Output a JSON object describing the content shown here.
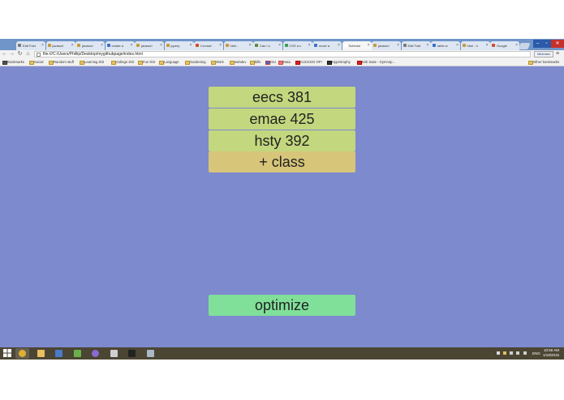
{
  "browser": {
    "tabs": [
      {
        "label": "Edit Fold",
        "color": "#7a7a7a"
      },
      {
        "label": "javascri",
        "color": "#c89a3a"
      },
      {
        "label": "javascri",
        "color": "#c89a3a"
      },
      {
        "label": "create a",
        "color": "#3a6fc8"
      },
      {
        "label": "javascri",
        "color": "#c89a3a"
      },
      {
        "label": "jquery",
        "color": "#c89a3a"
      },
      {
        "label": "Cronwe",
        "color": "#d24a2a"
      },
      {
        "label": "html -",
        "color": "#c89a3a"
      },
      {
        "label": "Can I u",
        "color": "#5a8a3a"
      },
      {
        "label": "CSS a c",
        "color": "#3aa04a"
      },
      {
        "label": "move a",
        "color": "#3a6fc8"
      },
      {
        "label": "Schedul",
        "color": "#ffffff"
      },
      {
        "label": "javascri",
        "color": "#c89a3a"
      },
      {
        "label": "Edit Fold",
        "color": "#7a7a7a"
      },
      {
        "label": "table w",
        "color": "#3a6fc8"
      },
      {
        "label": "html - h",
        "color": "#c89a3a"
      },
      {
        "label": "Google",
        "color": "#d24a2a"
      }
    ],
    "active_tab": 11,
    "window_controls": {
      "minimize": "–",
      "maximize": "▫",
      "close": "✕"
    },
    "address": "file:///C:/Users/Phillip/Desktop/mygithubpage/index.html",
    "extension_button": "Minimize",
    "bookmarks": [
      {
        "label": "Bookmarks",
        "icon": "star-icon"
      },
      {
        "label": "Social",
        "icon": "folder-icon"
      },
      {
        "label": "Random stuff",
        "icon": "folder-icon"
      },
      {
        "label": "Learning shit",
        "icon": "folder-icon"
      },
      {
        "label": "College shit",
        "icon": "folder-icon"
      },
      {
        "label": "Fun shit",
        "icon": "folder-icon"
      },
      {
        "label": "Language",
        "icon": "folder-icon"
      },
      {
        "label": "Gardening",
        "icon": "folder-icon"
      },
      {
        "label": "Work",
        "icon": "folder-icon"
      },
      {
        "label": "webdev",
        "icon": "folder-icon"
      },
      {
        "label": "bills",
        "icon": "folder-icon"
      },
      {
        "label": "ISU",
        "icon": "flag-icon"
      },
      {
        "label": "Data",
        "icon": "arrow-icon"
      },
      {
        "label": "CUCKOO OP!",
        "icon": "youtube-icon"
      },
      {
        "label": "Hypertrophy",
        "icon": "bb-icon"
      },
      {
        "label": "Erik Satie - Gymnop...",
        "icon": "youtube-icon"
      }
    ],
    "other_bookmarks": "Other bookmarks"
  },
  "app": {
    "classes": [
      {
        "label": "eecs 381"
      },
      {
        "label": "emae 425"
      },
      {
        "label": "hsty 392"
      }
    ],
    "add_class_label": "+ class",
    "optimize_label": "optimize",
    "colors": {
      "background": "#7e8ace",
      "class_button": "#c3d77e",
      "add_button": "#d7c57a",
      "optimize_button": "#80e09a"
    }
  },
  "taskbar": {
    "apps": [
      {
        "name": "chrome-icon",
        "active": true
      },
      {
        "name": "file-explorer-icon",
        "active": false
      },
      {
        "name": "document-icon",
        "active": false
      },
      {
        "name": "android-icon",
        "active": false
      },
      {
        "name": "circle-app-icon",
        "active": false
      },
      {
        "name": "window-app-icon",
        "active": false
      },
      {
        "name": "terminal-icon",
        "active": false
      },
      {
        "name": "notepad-icon",
        "active": false
      }
    ],
    "language": "ENG",
    "time": "10:56 AM",
    "date": "1/18/2015"
  }
}
